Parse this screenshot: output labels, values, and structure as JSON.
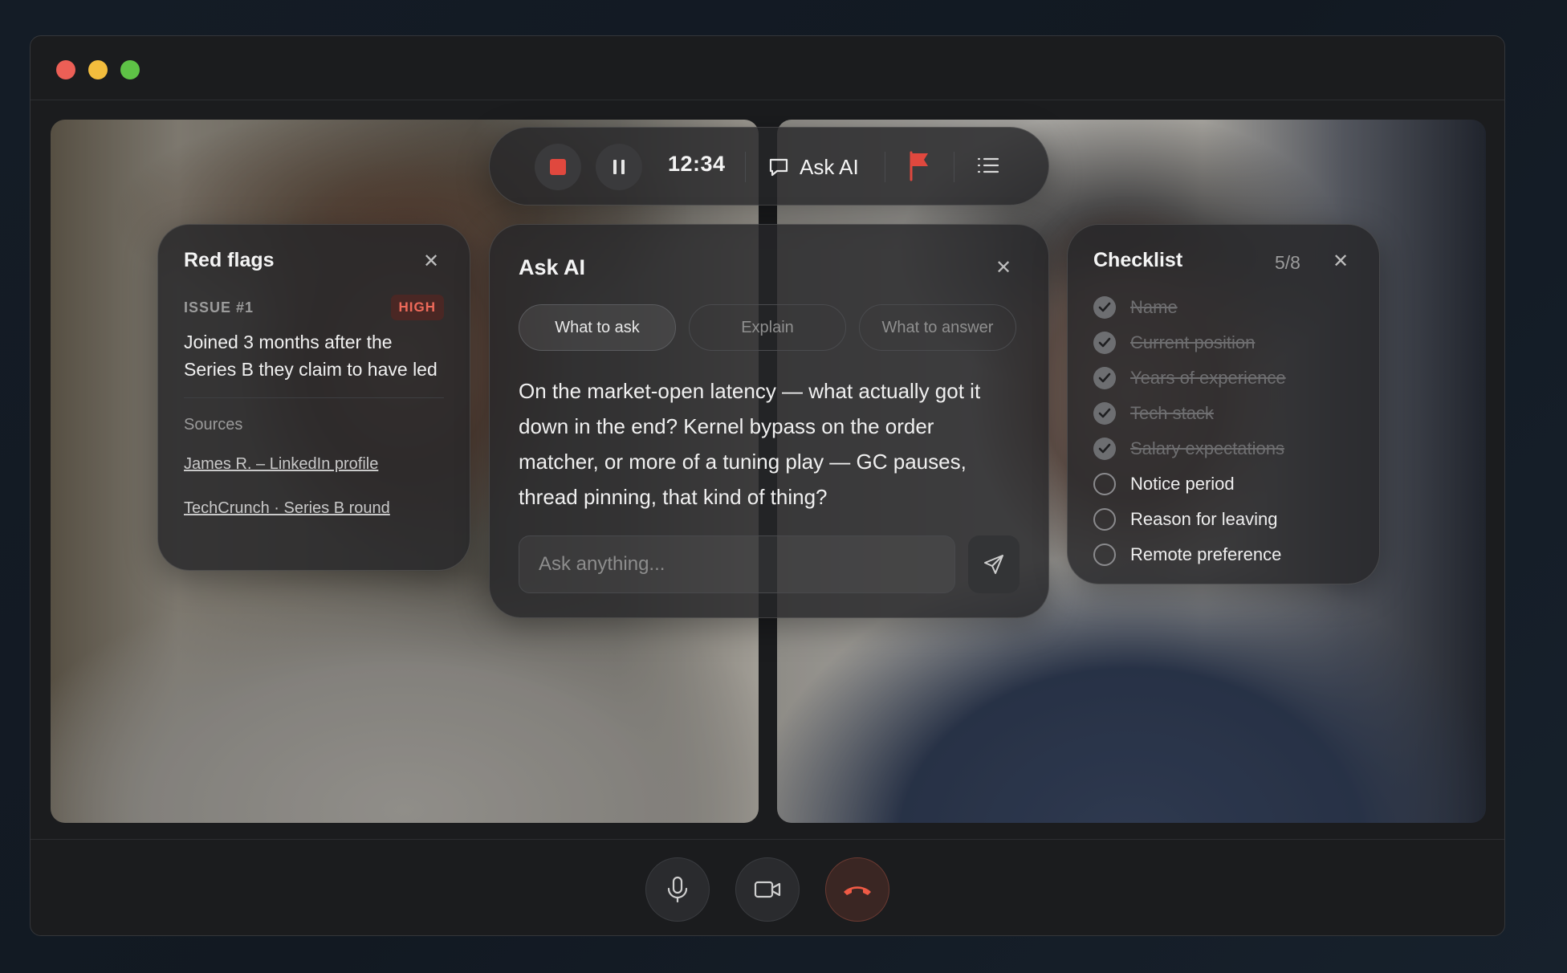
{
  "toolbar": {
    "timer": "12:34",
    "ask_label": "Ask AI"
  },
  "red_flags": {
    "title": "Red flags",
    "issue_label": "ISSUE #1",
    "severity": "HIGH",
    "issue_text": "Joined 3 months after the Series B they claim to have led",
    "sources_label": "Sources",
    "sources": [
      "James R. – LinkedIn profile",
      "TechCrunch · Series B round"
    ]
  },
  "ask_ai": {
    "title": "Ask AI",
    "tabs": [
      "What to ask",
      "Explain",
      "What to answer"
    ],
    "message": "On the market-open latency — what actually got it down in the end? Kernel bypass on the order matcher, or more of a tuning play — GC pauses, thread pinning, that kind of thing?",
    "input_placeholder": "Ask anything..."
  },
  "checklist": {
    "title": "Checklist",
    "count": "5/8",
    "items": [
      {
        "label": "Name",
        "done": true
      },
      {
        "label": "Current position",
        "done": true
      },
      {
        "label": "Years of experience",
        "done": true
      },
      {
        "label": "Tech stack",
        "done": true
      },
      {
        "label": "Salary expectations",
        "done": true
      },
      {
        "label": "Notice period",
        "done": false
      },
      {
        "label": "Reason for leaving",
        "done": false
      },
      {
        "label": "Remote preference",
        "done": false
      }
    ]
  },
  "colors": {
    "accent_red": "#e0483e",
    "badge_red": "#ef6a5a",
    "traffic_red": "#ec5f56",
    "traffic_yellow": "#f3bd3d",
    "traffic_green": "#5ec246"
  }
}
